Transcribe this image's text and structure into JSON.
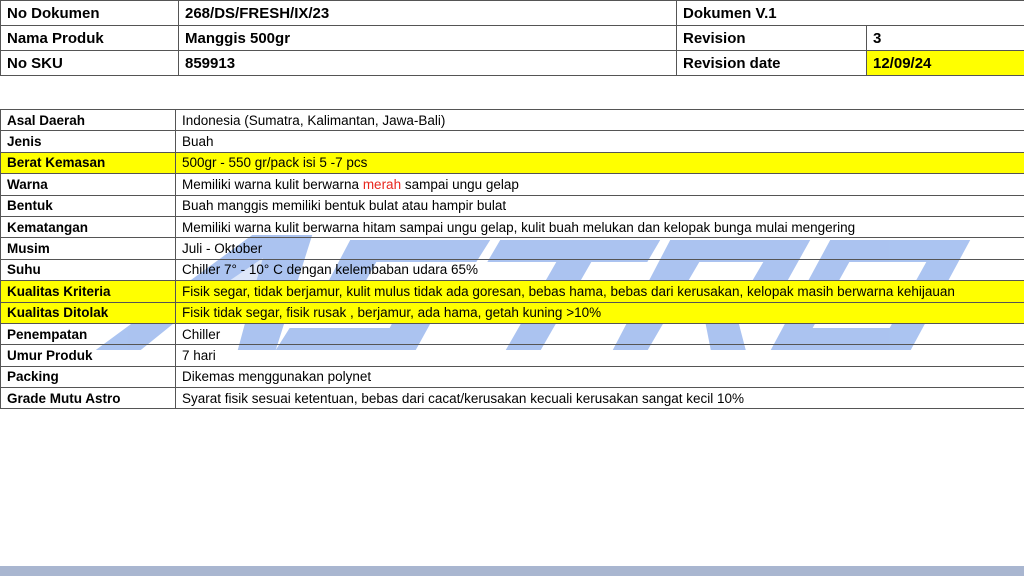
{
  "header": {
    "rows": [
      {
        "label": "No Dokumen",
        "value": "268/DS/FRESH/IX/23",
        "right_label": "Dokumen V.1",
        "right_value": ""
      },
      {
        "label": "Nama Produk",
        "value": "Manggis 500gr",
        "right_label": "Revision",
        "right_value": "3"
      },
      {
        "label": "No SKU",
        "value": "859913",
        "right_label": "Revision date",
        "right_value": "12/09/24"
      }
    ]
  },
  "spec": {
    "rows": [
      {
        "label": "Asal Daerah",
        "value": "Indonesia (Sumatra, Kalimantan, Jawa-Bali)"
      },
      {
        "label": "Jenis",
        "value": "Buah"
      },
      {
        "label": "Berat Kemasan",
        "value": "500gr - 550 gr/pack isi 5 -7 pcs"
      },
      {
        "label": "Warna",
        "value_pre": "Memiliki warna kulit berwarna ",
        "value_red": "merah",
        "value_post": " sampai ungu gelap"
      },
      {
        "label": "Bentuk",
        "value": "Buah manggis memiliki bentuk bulat atau hampir bulat"
      },
      {
        "label": "Kematangan",
        "value": "Memiliki warna kulit berwarna hitam sampai ungu gelap, kulit buah melukan dan kelopak bunga mulai mengering"
      },
      {
        "label": "Musim",
        "value": "Juli - Oktober"
      },
      {
        "label": "Suhu",
        "value": "Chiller 7° - 10° C dengan kelembaban udara 65%"
      },
      {
        "label": "Kualitas Kriteria",
        "value": "Fisik segar, tidak berjamur, kulit mulus tidak ada goresan, bebas hama, bebas dari kerusakan, kelopak masih berwarna kehijauan"
      },
      {
        "label": "Kualitas Ditolak",
        "value": "Fisik tidak segar, fisik rusak , berjamur, ada hama, getah kuning >10%"
      },
      {
        "label": "Penempatan",
        "value": "Chiller"
      },
      {
        "label": "Umur Produk",
        "value": "7 hari"
      },
      {
        "label": "Packing",
        "value": "Dikemas menggunakan polynet"
      },
      {
        "label": "Grade Mutu Astro",
        "value": "Syarat fisik sesuai ketentuan, bebas dari cacat/kerusakan kecuali kerusakan sangat kecil 10%"
      }
    ]
  },
  "colors": {
    "highlight": "#ffff00",
    "watermark": "#8fb0ec",
    "accent_text": "#e8281e",
    "footer_band": "#a9b6d0"
  },
  "watermark": {
    "text": "ASTRO",
    "icon": "astro-logo-watermark"
  }
}
